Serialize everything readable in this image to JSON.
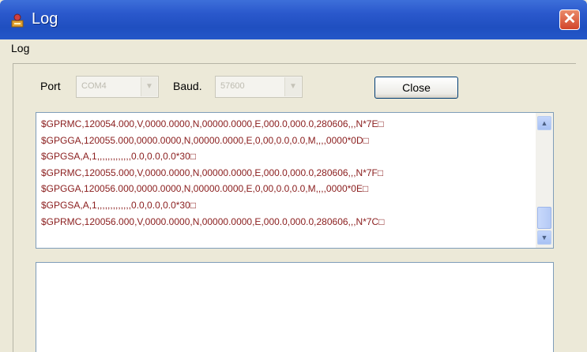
{
  "window": {
    "title": "Log",
    "close_glyph": "✕",
    "icon": "app-icon"
  },
  "menu": {
    "items": [
      "Log"
    ]
  },
  "controls": {
    "port_label": "Port",
    "port_value": "COM4",
    "baud_label": "Baud.",
    "baud_value": "57600",
    "close_label": "Close"
  },
  "log": {
    "lines": [
      "$GPRMC,120054.000,V,0000.0000,N,00000.0000,E,000.0,000.0,280606,,,N*7E□",
      "$GPGGA,120055.000,0000.0000,N,00000.0000,E,0,00,0.0,0.0,M,,,,0000*0D□",
      "$GPGSA,A,1,,,,,,,,,,,,,0.0,0.0,0.0*30□",
      "$GPRMC,120055.000,V,0000.0000,N,00000.0000,E,000.0,000.0,280606,,,N*7F□",
      "$GPGGA,120056.000,0000.0000,N,00000.0000,E,0,00,0.0,0.0,M,,,,0000*0E□",
      "$GPGSA,A,1,,,,,,,,,,,,,0.0,0.0,0.0*30□",
      "$GPRMC,120056.000,V,0000.0000,N,00000.0000,E,000.0,000.0,280606,,,N*7C□"
    ],
    "scroll_up_glyph": "▲",
    "scroll_down_glyph": "▼"
  },
  "command": {
    "value": ""
  },
  "colors": {
    "titlebar": "#2a58cc",
    "log_text": "#8a1d1d",
    "window_bg": "#ece9d8"
  }
}
